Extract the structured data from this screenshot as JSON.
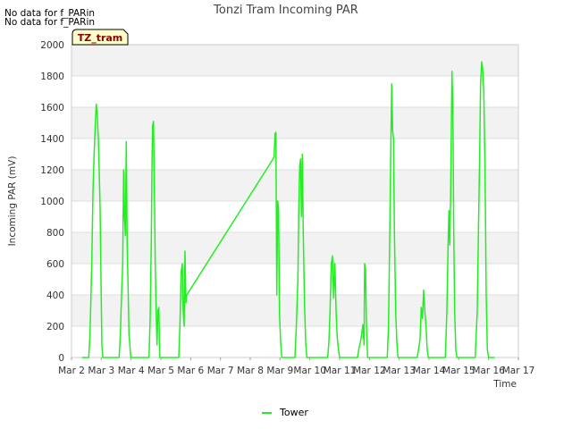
{
  "notes": [
    "No data for f_PARin",
    "No data for f_PARin"
  ],
  "badge": "TZ_tram",
  "colors": {
    "series": "#22ee22",
    "band": "#f2f2f2",
    "grid": "#dddddd",
    "badge_bg": "#ffffcc"
  },
  "chart_data": {
    "type": "line",
    "title": "Tonzi Tram Incoming PAR",
    "xlabel": "Time",
    "ylabel": "Incoming PAR (mV)",
    "xlim": [
      2,
      17
    ],
    "ylim": [
      0,
      2000
    ],
    "xticks": [
      {
        "value": 2,
        "label": "Mar 2"
      },
      {
        "value": 3,
        "label": "Mar 3"
      },
      {
        "value": 4,
        "label": "Mar 4"
      },
      {
        "value": 5,
        "label": "Mar 5"
      },
      {
        "value": 6,
        "label": "Mar 6"
      },
      {
        "value": 7,
        "label": "Mar 7"
      },
      {
        "value": 8,
        "label": "Mar 8"
      },
      {
        "value": 9,
        "label": "Mar 9"
      },
      {
        "value": 10,
        "label": "Mar 10"
      },
      {
        "value": 11,
        "label": "Mar 11"
      },
      {
        "value": 12,
        "label": "Mar 12"
      },
      {
        "value": 13,
        "label": "Mar 13"
      },
      {
        "value": 14,
        "label": "Mar 14"
      },
      {
        "value": 15,
        "label": "Mar 15"
      },
      {
        "value": 16,
        "label": "Mar 16"
      },
      {
        "value": 17,
        "label": "Mar 17"
      }
    ],
    "yticks": [
      0,
      200,
      400,
      600,
      800,
      1000,
      1200,
      1400,
      1600,
      1800,
      2000
    ],
    "grid": true,
    "legend_position": "bottom-center",
    "series": [
      {
        "name": "Tower",
        "color": "#22ee22",
        "points": [
          [
            2.35,
            0
          ],
          [
            2.58,
            0
          ],
          [
            2.62,
            150
          ],
          [
            2.68,
            600
          ],
          [
            2.72,
            1050
          ],
          [
            2.76,
            1300
          ],
          [
            2.8,
            1500
          ],
          [
            2.83,
            1620
          ],
          [
            2.86,
            1560
          ],
          [
            2.9,
            1400
          ],
          [
            2.93,
            1200
          ],
          [
            2.96,
            950
          ],
          [
            2.99,
            500
          ],
          [
            3.02,
            80
          ],
          [
            3.05,
            0
          ],
          [
            3.6,
            0
          ],
          [
            3.64,
            150
          ],
          [
            3.68,
            400
          ],
          [
            3.72,
            600
          ],
          [
            3.75,
            1200
          ],
          [
            3.78,
            900
          ],
          [
            3.81,
            780
          ],
          [
            3.84,
            1380
          ],
          [
            3.87,
            720
          ],
          [
            3.9,
            450
          ],
          [
            3.93,
            150
          ],
          [
            3.96,
            80
          ],
          [
            3.99,
            0
          ],
          [
            4.6,
            0
          ],
          [
            4.64,
            250
          ],
          [
            4.68,
            750
          ],
          [
            4.7,
            1200
          ],
          [
            4.72,
            1480
          ],
          [
            4.75,
            1510
          ],
          [
            4.78,
            1100
          ],
          [
            4.81,
            600
          ],
          [
            4.84,
            300
          ],
          [
            4.87,
            80
          ],
          [
            4.9,
            300
          ],
          [
            4.93,
            320
          ],
          [
            4.96,
            0
          ],
          [
            5.6,
            0
          ],
          [
            5.64,
            200
          ],
          [
            5.68,
            550
          ],
          [
            5.72,
            600
          ],
          [
            5.75,
            300
          ],
          [
            5.78,
            200
          ],
          [
            5.81,
            680
          ],
          [
            5.84,
            350
          ],
          [
            5.87,
            400
          ],
          [
            8.8,
            1280
          ],
          [
            8.83,
            1430
          ],
          [
            8.86,
            1440
          ],
          [
            8.89,
            400
          ],
          [
            8.92,
            1000
          ],
          [
            8.95,
            950
          ],
          [
            8.98,
            280
          ],
          [
            9.02,
            100
          ],
          [
            9.06,
            0
          ],
          [
            9.5,
            0
          ],
          [
            9.55,
            220
          ],
          [
            9.6,
            500
          ],
          [
            9.63,
            950
          ],
          [
            9.66,
            1220
          ],
          [
            9.69,
            1270
          ],
          [
            9.72,
            900
          ],
          [
            9.75,
            1300
          ],
          [
            9.78,
            800
          ],
          [
            9.82,
            350
          ],
          [
            9.86,
            100
          ],
          [
            9.9,
            0
          ],
          [
            10.6,
            0
          ],
          [
            10.64,
            100
          ],
          [
            10.68,
            300
          ],
          [
            10.72,
            600
          ],
          [
            10.76,
            650
          ],
          [
            10.8,
            380
          ],
          [
            10.84,
            600
          ],
          [
            10.88,
            300
          ],
          [
            10.92,
            130
          ],
          [
            10.96,
            50
          ],
          [
            11.0,
            0
          ],
          [
            11.6,
            0
          ],
          [
            11.65,
            60
          ],
          [
            11.7,
            100
          ],
          [
            11.74,
            150
          ],
          [
            11.78,
            210
          ],
          [
            11.82,
            80
          ],
          [
            11.84,
            600
          ],
          [
            11.87,
            560
          ],
          [
            11.9,
            200
          ],
          [
            11.94,
            0
          ],
          [
            12.6,
            0
          ],
          [
            12.64,
            200
          ],
          [
            12.68,
            750
          ],
          [
            12.72,
            1350
          ],
          [
            12.75,
            1750
          ],
          [
            12.78,
            1450
          ],
          [
            12.81,
            1400
          ],
          [
            12.84,
            800
          ],
          [
            12.88,
            300
          ],
          [
            12.92,
            100
          ],
          [
            12.96,
            0
          ],
          [
            13.6,
            0
          ],
          [
            13.65,
            50
          ],
          [
            13.7,
            120
          ],
          [
            13.74,
            320
          ],
          [
            13.78,
            250
          ],
          [
            13.82,
            430
          ],
          [
            13.86,
            300
          ],
          [
            13.9,
            200
          ],
          [
            13.94,
            50
          ],
          [
            13.98,
            0
          ],
          [
            14.55,
            0
          ],
          [
            14.6,
            300
          ],
          [
            14.64,
            700
          ],
          [
            14.67,
            940
          ],
          [
            14.7,
            720
          ],
          [
            14.73,
            1080
          ],
          [
            14.77,
            1830
          ],
          [
            14.8,
            1600
          ],
          [
            14.83,
            800
          ],
          [
            14.86,
            300
          ],
          [
            14.9,
            50
          ],
          [
            14.94,
            0
          ],
          [
            15.55,
            0
          ],
          [
            15.62,
            300
          ],
          [
            15.66,
            800
          ],
          [
            15.7,
            1300
          ],
          [
            15.73,
            1750
          ],
          [
            15.77,
            1890
          ],
          [
            15.8,
            1850
          ],
          [
            15.84,
            1700
          ],
          [
            15.88,
            1200
          ],
          [
            15.92,
            400
          ],
          [
            15.96,
            50
          ],
          [
            16.0,
            0
          ],
          [
            16.2,
            0
          ]
        ]
      }
    ]
  }
}
